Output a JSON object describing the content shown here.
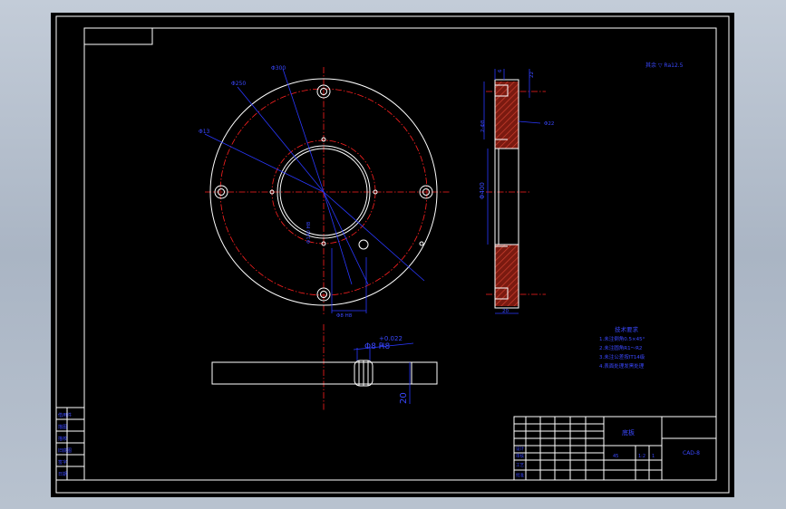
{
  "colors": {
    "background": "#000000",
    "geometry": "#ffffff",
    "centerline": "#ff2020",
    "dimension": "#2a38ff",
    "section_hatch": "#c03020"
  },
  "dimensions": {
    "d_outer": "Φ300",
    "d_bolt": "Φ250",
    "d_hole": "Φ13",
    "d_bore": "Φ140 H8",
    "width_slot": "Φ8 H8",
    "d_face": "Φ400",
    "thickness": "20",
    "tolerance": "+0.022",
    "tolerance_zero": "0",
    "top_depth": "6",
    "top_right": "22",
    "side_h": "2-Φ8",
    "side_r": "Φ22",
    "bottom_w": "20",
    "roughness": "其余 ▽ Ra12.5"
  },
  "tech_notes": {
    "title": "技术要求",
    "items": [
      "1.未注倒角0.5×45°",
      "2.未注圆角R1～R2",
      "3.未注公差按IT14级",
      "4.表面处理发黑处理"
    ]
  },
  "title_block": {
    "part_name": "底板",
    "material": "45",
    "code": "CAD-8",
    "scale": "1:2",
    "sheet": "1",
    "row_labels": [
      "设计",
      "审核",
      "工艺",
      "批准"
    ]
  },
  "left_strip": {
    "labels": [
      "借用件",
      "描图",
      "描校",
      "旧底图",
      "签字",
      "日期"
    ]
  }
}
